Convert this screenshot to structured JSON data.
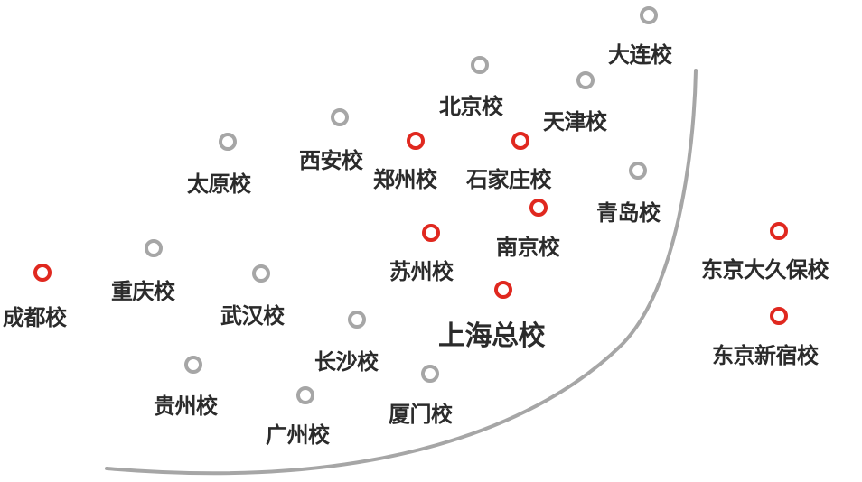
{
  "campuses": [
    {
      "id": "dalian",
      "name": "大连校",
      "status": "inactive"
    },
    {
      "id": "beijing",
      "name": "北京校",
      "status": "inactive"
    },
    {
      "id": "tianjin",
      "name": "天津校",
      "status": "inactive"
    },
    {
      "id": "xian",
      "name": "西安校",
      "status": "inactive"
    },
    {
      "id": "taiyuan",
      "name": "太原校",
      "status": "inactive"
    },
    {
      "id": "zhengzhou",
      "name": "郑州校",
      "status": "active"
    },
    {
      "id": "shijiazhuang",
      "name": "石家庄校",
      "status": "active"
    },
    {
      "id": "qingdao",
      "name": "青岛校",
      "status": "inactive"
    },
    {
      "id": "nanjing",
      "name": "南京校",
      "status": "active"
    },
    {
      "id": "suzhou",
      "name": "苏州校",
      "status": "active"
    },
    {
      "id": "shanghai",
      "name": "上海总校",
      "status": "active"
    },
    {
      "id": "chengdu",
      "name": "成都校",
      "status": "active"
    },
    {
      "id": "chongqing",
      "name": "重庆校",
      "status": "inactive"
    },
    {
      "id": "wuhan",
      "name": "武汉校",
      "status": "inactive"
    },
    {
      "id": "changsha",
      "name": "长沙校",
      "status": "inactive"
    },
    {
      "id": "guiyang",
      "name": "贵州校",
      "status": "inactive"
    },
    {
      "id": "guangzhou",
      "name": "广州校",
      "status": "inactive"
    },
    {
      "id": "xiamen",
      "name": "厦门校",
      "status": "inactive"
    },
    {
      "id": "tokyo-okubo",
      "name": "东京大久保校",
      "status": "active"
    },
    {
      "id": "tokyo-shinjuku",
      "name": "东京新宿校",
      "status": "active"
    }
  ],
  "colors": {
    "active": "#e0281f",
    "inactive": "#a6a6a6",
    "coastline": "#a6a6a6",
    "text": "#2b2b2b"
  }
}
